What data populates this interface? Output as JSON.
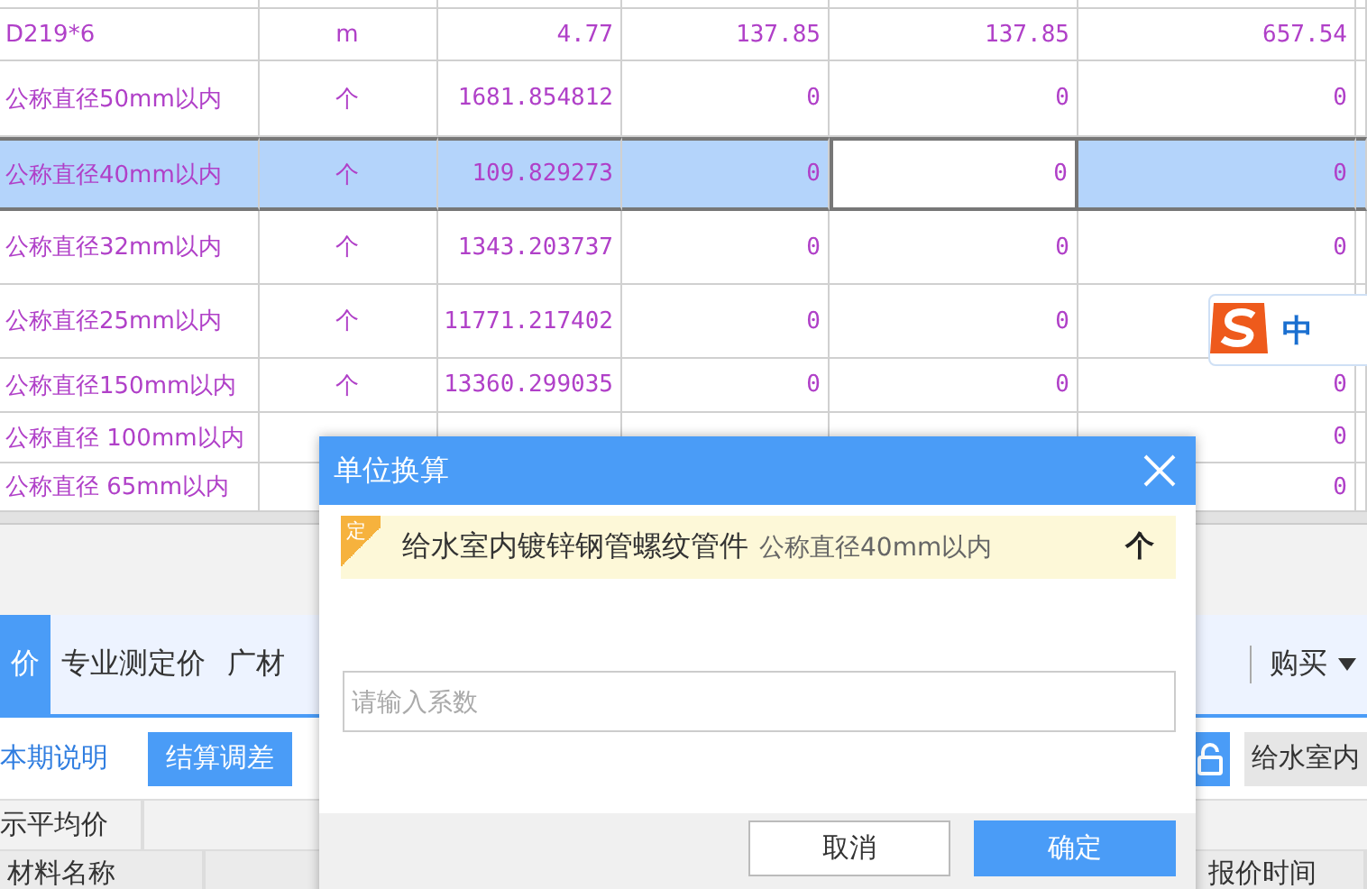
{
  "table": {
    "rows": [
      {
        "selected": false,
        "cells": [
          {
            "text": "D219*6"
          },
          {
            "text": "m"
          },
          {
            "text": "4.77"
          },
          {
            "text": "137.85"
          },
          {
            "text": "137.85"
          },
          {
            "text": "657.54"
          }
        ]
      },
      {
        "selected": false,
        "cells": [
          {
            "text": "公称直径50mm以内"
          },
          {
            "text": "个"
          },
          {
            "text": "1681.854812"
          },
          {
            "text": "0"
          },
          {
            "text": "0"
          },
          {
            "text": "0"
          }
        ]
      },
      {
        "selected": true,
        "cells": [
          {
            "text": "公称直径40mm以内",
            "focused": false
          },
          {
            "text": "个",
            "focused": false
          },
          {
            "text": "109.829273",
            "focused": false
          },
          {
            "text": "0",
            "focused": false
          },
          {
            "text": "0",
            "focused": true
          },
          {
            "text": "0",
            "focused": false
          }
        ]
      },
      {
        "selected": false,
        "cells": [
          {
            "text": "公称直径32mm以内"
          },
          {
            "text": "个"
          },
          {
            "text": "1343.203737"
          },
          {
            "text": "0"
          },
          {
            "text": "0"
          },
          {
            "text": "0"
          }
        ]
      },
      {
        "selected": false,
        "cells": [
          {
            "text": "公称直径25mm以内"
          },
          {
            "text": "个"
          },
          {
            "text": "11771.217402"
          },
          {
            "text": "0"
          },
          {
            "text": "0"
          },
          {}
        ]
      },
      {
        "selected": false,
        "cells": [
          {
            "text": "公称直径150mm以内"
          },
          {
            "text": "个"
          },
          {
            "text": "13360.299035"
          },
          {
            "text": "0"
          },
          {
            "text": "0"
          },
          {
            "text": "0"
          }
        ]
      },
      {
        "selected": false,
        "cells": [
          {
            "text": "公称直径 100mm以内"
          },
          {},
          {},
          {},
          {},
          {
            "text": "0"
          }
        ]
      },
      {
        "selected": false,
        "cells": [
          {
            "text": "公称直径 65mm以内"
          },
          {},
          {},
          {},
          {},
          {
            "text": "0"
          }
        ]
      }
    ]
  },
  "tabs": [
    {
      "label": "价",
      "selected": true
    },
    {
      "label": "专业测定价",
      "selected": false
    },
    {
      "label": "广材",
      "selected": false
    }
  ],
  "buy_menu": {
    "label": "购买"
  },
  "toolbar": {
    "buttons": [
      {
        "label": "本期说明",
        "kind": "outline"
      },
      {
        "label": "结算调差",
        "kind": "primary"
      }
    ],
    "search_tag": "给水室内"
  },
  "filter": {
    "label": "示平均价"
  },
  "columns": [
    {
      "label": "材料名称"
    },
    {
      "label": "报价时间"
    }
  ],
  "ime": {
    "label": "中"
  },
  "dialog": {
    "title": "单位换算",
    "badge": "定",
    "material": "给水室内镀锌钢管螺纹管件",
    "spec": "公称直径40mm以内",
    "unit": "个",
    "input": {
      "placeholder": "请输入系数"
    },
    "buttons": [
      {
        "label": "取消",
        "kind": "secondary"
      },
      {
        "label": "确定",
        "kind": "primary"
      }
    ]
  }
}
